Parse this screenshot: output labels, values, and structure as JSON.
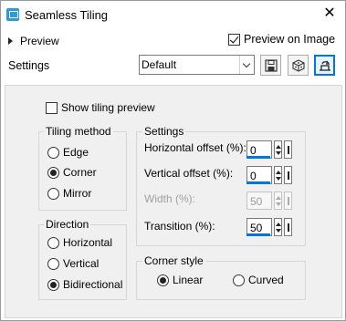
{
  "window": {
    "title": "Seamless Tiling",
    "close_glyph": "✕"
  },
  "preview": {
    "toggle_label": "Preview",
    "on_image_label": "Preview on Image",
    "on_image_checked": true
  },
  "settings": {
    "label": "Settings",
    "preset_value": "Default"
  },
  "show_tiling_preview": {
    "label": "Show tiling preview",
    "checked": false
  },
  "tiling_method": {
    "label": "Tiling method",
    "options": [
      {
        "label": "Edge",
        "selected": false
      },
      {
        "label": "Corner",
        "selected": true
      },
      {
        "label": "Mirror",
        "selected": false
      }
    ]
  },
  "direction": {
    "label": "Direction",
    "options": [
      {
        "label": "Horizontal",
        "selected": false
      },
      {
        "label": "Vertical",
        "selected": false
      },
      {
        "label": "Bidirectional",
        "selected": true
      }
    ]
  },
  "settings_group": {
    "label": "Settings",
    "fields": [
      {
        "label": "Horizontal offset (%):",
        "value": "0",
        "enabled": true
      },
      {
        "label": "Vertical offset (%):",
        "value": "0",
        "enabled": true
      },
      {
        "label": "Width (%):",
        "value": "50",
        "enabled": false
      },
      {
        "label": "Transition (%):",
        "value": "50",
        "enabled": true
      }
    ]
  },
  "corner_style": {
    "label": "Corner style",
    "options": [
      {
        "label": "Linear",
        "selected": true
      },
      {
        "label": "Curved",
        "selected": false
      }
    ]
  },
  "colors": {
    "accent": "#0078d7",
    "panel_bg": "#f0f0f0"
  }
}
